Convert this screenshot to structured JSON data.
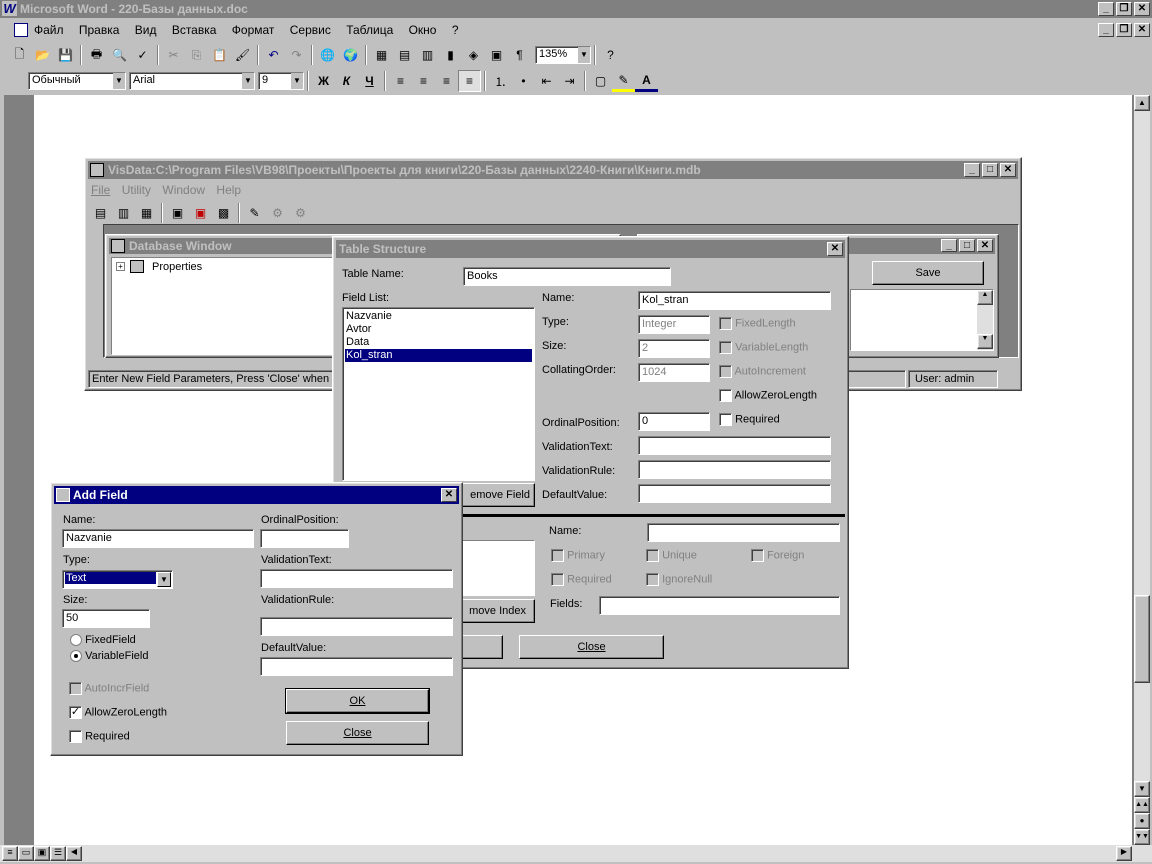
{
  "word": {
    "title": "Microsoft Word - 220-Базы данных.doc",
    "menu": [
      "Файл",
      "Правка",
      "Вид",
      "Вставка",
      "Формат",
      "Сервис",
      "Таблица",
      "Окно",
      "?"
    ],
    "zoom": "135%",
    "style": "Обычный",
    "font": "Arial",
    "size": "9",
    "bold": "Ж",
    "italic": "К",
    "underline": "Ч"
  },
  "visdata": {
    "title": "VisData:C:\\Program Files\\VB98\\Проекты\\Проекты для книги\\220-Базы данных\\2240-Книги\\Книги.mdb",
    "menu": [
      "File",
      "Utility",
      "Window",
      "Help"
    ],
    "db_window_title": "Database Window",
    "tree_item": "Properties",
    "save": "Save",
    "status_left": "Enter New Field Parameters, Press 'Close' when fin",
    "status_user": "User: admin"
  },
  "table_structure": {
    "title": "Table Structure",
    "table_name_label": "Table Name:",
    "table_name": "Books",
    "field_list_label": "Field List:",
    "fields": [
      "Nazvanie",
      "Avtor",
      "Data",
      "Kol_stran"
    ],
    "selected_field": "Kol_stran",
    "name_label": "Name:",
    "name": "Kol_stran",
    "type_label": "Type:",
    "type": "Integer",
    "size_label": "Size:",
    "size": "2",
    "collating_label": "CollatingOrder:",
    "collating": "1024",
    "fixed_length": "FixedLength",
    "variable_length": "VariableLength",
    "auto_increment": "AutoIncrement",
    "allow_zero_length": "AllowZeroLength",
    "required": "Required",
    "ordinal_label": "OrdinalPosition:",
    "ordinal": "0",
    "validation_text_label": "ValidationText:",
    "validation_rule_label": "ValidationRule:",
    "default_value_label": "DefaultValue:",
    "remove_field": "emove Field",
    "index_name_label": "Name:",
    "primary": "Primary",
    "unique": "Unique",
    "foreign": "Foreign",
    "index_required": "Required",
    "ignore_null": "IgnoreNull",
    "fields_label": "Fields:",
    "remove_index": "move Index",
    "close": "Close"
  },
  "add_field": {
    "title": "Add Field",
    "name_label": "Name:",
    "name": "Nazvanie",
    "type_label": "Type:",
    "type": "Text",
    "size_label": "Size:",
    "size": "50",
    "fixed_field": "FixedField",
    "variable_field": "VariableField",
    "auto_incr": "AutoIncrField",
    "allow_zero": "AllowZeroLength",
    "required": "Required",
    "ordinal_label": "OrdinalPosition:",
    "validation_text_label": "ValidationText:",
    "validation_rule_label": "ValidationRule:",
    "default_value_label": "DefaultValue:",
    "ok": "OK",
    "close": "Close"
  }
}
